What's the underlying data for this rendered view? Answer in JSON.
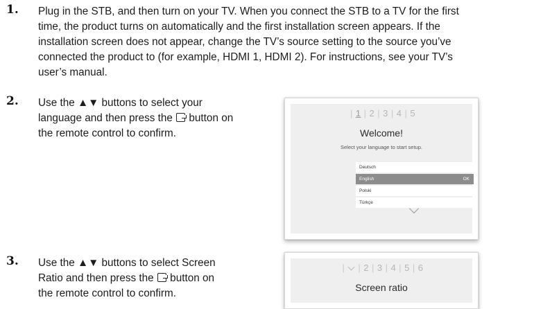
{
  "steps": [
    {
      "number": "1.",
      "lines": [
        "Plug in the STB, and then turn on your TV. When you connect the STB to a TV for the first",
        "time, the product turns on automatically and the first installation screen appears. If the",
        "installation screen does not appear, change the TV’s source setting to the source you’ve",
        "connected the product to (for example, HDMI 1, HDMI  2). For instructions, see your TV’s",
        "user’s manual."
      ]
    },
    {
      "number": "2.",
      "line1_a": "Use the ",
      "line1_arrows": "▲▼",
      "line1_b": " buttons to select your",
      "line2_a": "language and then press the ",
      "line2_b": " button on",
      "line3": "the remote control to confirm."
    },
    {
      "number": "3.",
      "line1_a": "Use the ",
      "line1_arrows": "▲▼",
      "line1_b": " buttons to select  Screen",
      "line2_a": "Ratio  and then press the ",
      "line2_b": " button on",
      "line3": "the remote control to confirm."
    }
  ],
  "screen1": {
    "progress": [
      "1",
      "2",
      "3",
      "4",
      "5"
    ],
    "title": "Welcome!",
    "subtitle": "Select your language to start setup.",
    "languages": [
      {
        "label": "Deutsch",
        "selected": false,
        "ok": ""
      },
      {
        "label": "English",
        "selected": true,
        "ok": "OK"
      },
      {
        "label": "Polski",
        "selected": false,
        "ok": ""
      },
      {
        "label": "Türkçe",
        "selected": false,
        "ok": ""
      }
    ]
  },
  "screen2": {
    "progress": [
      "2",
      "3",
      "4",
      "5",
      "6"
    ],
    "title": "Screen ratio"
  },
  "icons": {
    "enter": "enter-button-icon",
    "up_down": "up-down-arrows"
  }
}
